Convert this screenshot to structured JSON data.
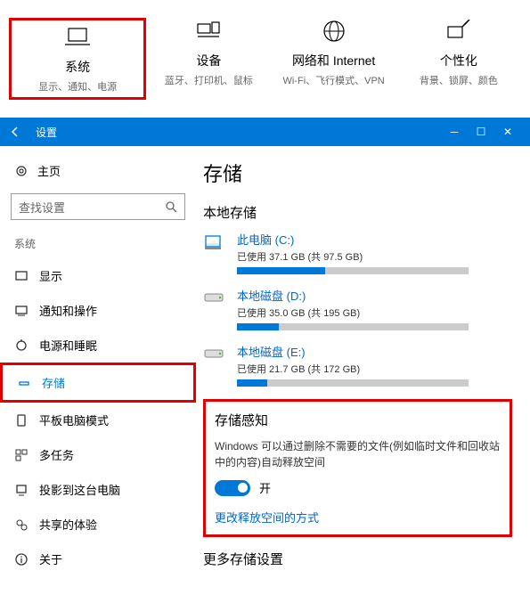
{
  "topnav": [
    {
      "title": "系统",
      "sub": "显示、通知、电源",
      "highlight": true
    },
    {
      "title": "设备",
      "sub": "蓝牙、打印机、鼠标"
    },
    {
      "title": "网络和 Internet",
      "sub": "Wi-Fi、飞行模式、VPN"
    },
    {
      "title": "个性化",
      "sub": "背景、锁屏、颜色"
    }
  ],
  "titlebar": {
    "label": "设置"
  },
  "sidebar": {
    "home": "主页",
    "search_placeholder": "查找设置",
    "section": "系统",
    "items": [
      {
        "label": "显示"
      },
      {
        "label": "通知和操作"
      },
      {
        "label": "电源和睡眠"
      },
      {
        "label": "存储",
        "highlight": true
      },
      {
        "label": "平板电脑模式"
      },
      {
        "label": "多任务"
      },
      {
        "label": "投影到这台电脑"
      },
      {
        "label": "共享的体验"
      },
      {
        "label": "关于"
      }
    ]
  },
  "content": {
    "h1": "存储",
    "local_heading": "本地存储",
    "drives": [
      {
        "name": "此电脑 (C:)",
        "info": "已使用 37.1 GB (共 97.5 GB)",
        "pct": 38
      },
      {
        "name": "本地磁盘 (D:)",
        "info": "已使用 35.0 GB (共 195 GB)",
        "pct": 18
      },
      {
        "name": "本地磁盘 (E:)",
        "info": "已使用 21.7 GB (共 172 GB)",
        "pct": 13
      }
    ],
    "sense": {
      "heading": "存储感知",
      "desc": "Windows 可以通过删除不需要的文件(例如临时文件和回收站中的内容)自动释放空间",
      "toggle_label": "开",
      "link": "更改释放空间的方式"
    },
    "more_heading": "更多存储设置"
  }
}
